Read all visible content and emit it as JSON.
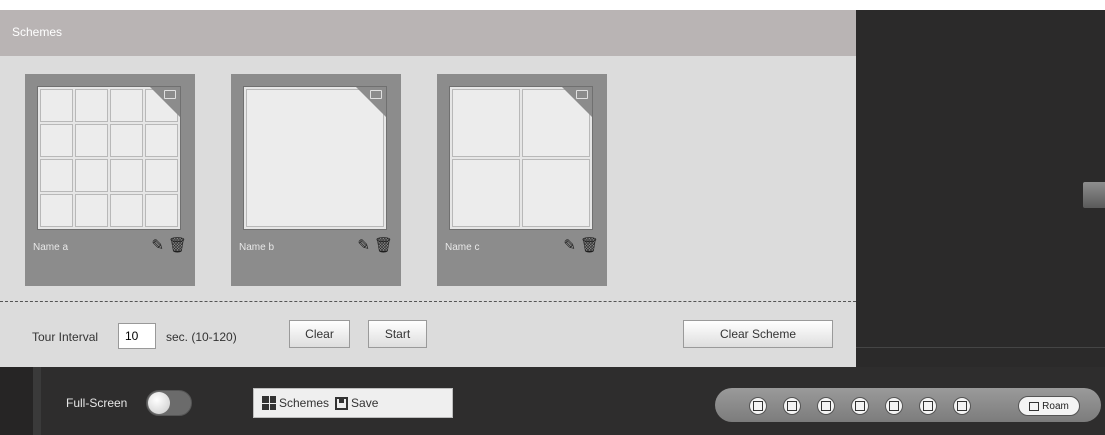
{
  "panel": {
    "title": "Schemes"
  },
  "schemes": [
    {
      "name": "Name a",
      "layout": "16-split"
    },
    {
      "name": "Name b",
      "layout": "1-split"
    },
    {
      "name": "Name c",
      "layout": "4-split"
    }
  ],
  "icons": {
    "edit": "pencil-icon",
    "delete": "trash-icon",
    "card_corner": "window-restore-icon"
  },
  "tour": {
    "label": "Tour Interval",
    "value": "10",
    "unit": "sec. (10-120)"
  },
  "buttons": {
    "clear": "Clear",
    "start": "Start",
    "clear_scheme": "Clear Scheme"
  },
  "bottom_bar": {
    "fullscreen_label": "Full-Screen",
    "schemes_label": "Schemes",
    "save_label": "Save",
    "roam_label": "Roam",
    "layouts": [
      "1-split",
      "4-split",
      "9-split",
      "16-split",
      "custom-1",
      "custom-2",
      "custom-3"
    ]
  },
  "colors": {
    "panel_bg": "#dcdcdc",
    "header_bg": "#b9b4b4",
    "card_bg": "#8c8c8c",
    "dark_bg": "#2b2a2a"
  }
}
